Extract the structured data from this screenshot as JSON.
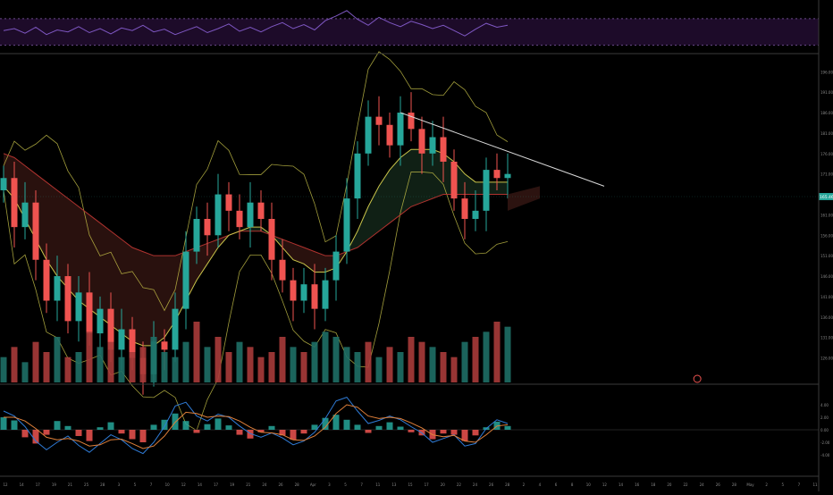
{
  "colors": {
    "background": "#000000",
    "pane_border": "#3a3a3a",
    "axis_text": "#8a8a8a",
    "candle_up": "#26a69a",
    "candle_down": "#ef5350",
    "volume_up": "#1e6f66",
    "volume_down": "#a83b3a",
    "rsi_line": "#7e57c2",
    "rsi_band": "#2a0f3a",
    "bb_band": "#c9c44a",
    "ema_short": "#c9c44a",
    "ema_long": "#b0332f",
    "cloud_bull": "#1d3a26",
    "cloud_bear": "#4a1f1a",
    "trendline": "#d8d8d8",
    "macd_line": "#2f7bd6",
    "signal_line": "#e0803a",
    "hist_up": "#26a69a",
    "hist_down": "#ef5350",
    "price_tag": "#26a69a",
    "event_marker": "#ef5350"
  },
  "icons": {
    "event_marker": "earnings-event-icon"
  },
  "chart_data": [
    {
      "type": "line",
      "name": "rsi-pane",
      "overbought": 70,
      "oversold": 30,
      "ylim": [
        20,
        90
      ],
      "x_range": [
        0,
        48
      ],
      "values": [
        52,
        55,
        48,
        57,
        46,
        53,
        50,
        58,
        49,
        55,
        47,
        56,
        52,
        60,
        50,
        54,
        46,
        52,
        58,
        49,
        55,
        62,
        51,
        57,
        50,
        58,
        64,
        55,
        61,
        53,
        67,
        74,
        82,
        69,
        60,
        72,
        64,
        58,
        66,
        61,
        55,
        60,
        52,
        44,
        54,
        63,
        57,
        60
      ]
    },
    {
      "type": "line",
      "name": "price-pane",
      "ylim": [
        120,
        200
      ],
      "x_range": [
        0,
        48
      ],
      "projection_end": 56,
      "close": [
        170,
        158,
        164,
        150,
        140,
        146,
        135,
        142,
        132,
        138,
        128,
        133,
        126,
        122,
        130,
        128,
        138,
        152,
        160,
        156,
        166,
        162,
        158,
        164,
        160,
        150,
        145,
        140,
        144,
        138,
        145,
        152,
        165,
        176,
        185,
        183,
        178,
        186,
        182,
        176,
        180,
        174,
        165,
        160,
        162,
        172,
        170,
        171
      ],
      "ema_short": [
        168,
        165,
        160,
        155,
        150,
        146,
        143,
        140,
        138,
        136,
        134,
        132,
        130,
        129,
        129,
        131,
        135,
        140,
        145,
        149,
        153,
        156,
        157,
        158,
        158,
        156,
        153,
        150,
        149,
        147,
        147,
        148,
        152,
        157,
        163,
        168,
        172,
        175,
        177,
        177,
        177,
        176,
        174,
        171,
        169,
        169,
        169,
        169
      ],
      "ema_long": [
        176,
        175,
        173,
        171,
        169,
        167,
        165,
        163,
        161,
        159,
        157,
        155,
        153,
        152,
        151,
        151,
        151,
        152,
        153,
        154,
        155,
        156,
        157,
        157,
        157,
        156,
        155,
        154,
        153,
        152,
        151,
        151,
        152,
        153,
        155,
        157,
        159,
        161,
        163,
        164,
        165,
        166,
        166,
        166,
        166,
        166,
        166,
        166
      ],
      "trendline": {
        "x": [
          37,
          56
        ],
        "y": [
          186,
          168
        ]
      },
      "event_marker_index": 66,
      "y_ticks": [
        126,
        131,
        136,
        141,
        146,
        151,
        156,
        161,
        166,
        171,
        176,
        181,
        186,
        191,
        196
      ],
      "current_price": "165.46",
      "x_tick_labels": [
        "12",
        "14",
        "17",
        "19",
        "21",
        "25",
        "28",
        "3",
        "5",
        "7",
        "10",
        "12",
        "14",
        "17",
        "19",
        "21",
        "24",
        "26",
        "28",
        "Apr",
        "3",
        "5",
        "7",
        "11",
        "13",
        "15",
        "17",
        "20",
        "22",
        "24",
        "26",
        "28",
        "2",
        "4",
        "6",
        "8",
        "10",
        "12",
        "14",
        "16",
        "18",
        "20",
        "22",
        "24",
        "26",
        "28",
        "May",
        "2",
        "5",
        "7",
        "11"
      ]
    },
    {
      "type": "bar",
      "name": "volume",
      "values": [
        5,
        7,
        4,
        8,
        6,
        9,
        5,
        6,
        10,
        7,
        8,
        5,
        6,
        7,
        9,
        6,
        5,
        8,
        12,
        7,
        9,
        6,
        8,
        7,
        5,
        6,
        9,
        7,
        6,
        8,
        10,
        9,
        7,
        6,
        8,
        5,
        7,
        6,
        9,
        8,
        7,
        6,
        5,
        8,
        9,
        10,
        12,
        11
      ],
      "directions": [
        1,
        0,
        1,
        0,
        0,
        1,
        0,
        1,
        0,
        1,
        0,
        1,
        0,
        0,
        1,
        1,
        1,
        1,
        0,
        1,
        0,
        0,
        1,
        0,
        0,
        0,
        0,
        1,
        0,
        1,
        1,
        1,
        1,
        1,
        0,
        1,
        0,
        1,
        0,
        0,
        1,
        0,
        0,
        1,
        0,
        1,
        0,
        1
      ]
    },
    {
      "type": "bar",
      "name": "macd-pane",
      "ylim": [
        -7,
        7
      ],
      "y_ticks": [
        "4.00",
        "2.00",
        "0.00",
        "-2.00",
        "-4.00"
      ],
      "histogram": [
        2.0,
        1.5,
        -1.2,
        -2.2,
        -0.8,
        1.4,
        0.6,
        -1.0,
        -1.8,
        0.4,
        1.2,
        -0.6,
        -1.5,
        -2.0,
        0.8,
        1.6,
        2.6,
        1.4,
        -0.5,
        0.9,
        1.8,
        0.7,
        -0.8,
        -1.4,
        -0.4,
        0.6,
        -0.9,
        -1.6,
        -0.6,
        0.8,
        1.9,
        2.4,
        1.6,
        0.8,
        -0.5,
        0.6,
        1.2,
        0.5,
        -0.4,
        -0.9,
        -1.5,
        -0.6,
        -0.8,
        -1.8,
        -0.9,
        0.4,
        1.3,
        0.6
      ],
      "macd": [
        3.0,
        2.2,
        0.5,
        -1.8,
        -3.2,
        -2.0,
        -1.0,
        -2.5,
        -3.6,
        -2.2,
        -0.8,
        -1.6,
        -3.0,
        -3.8,
        -2.0,
        0.5,
        3.8,
        4.4,
        2.2,
        1.4,
        2.5,
        2.0,
        0.6,
        -0.6,
        -1.2,
        -0.5,
        -1.3,
        -2.4,
        -1.8,
        -0.4,
        1.8,
        4.6,
        5.2,
        3.0,
        1.0,
        1.5,
        2.2,
        1.6,
        0.5,
        -0.5,
        -2.0,
        -1.4,
        -0.8,
        -2.6,
        -2.2,
        0.2,
        1.6,
        1.0
      ],
      "signal": [
        2.0,
        2.0,
        1.4,
        0.2,
        -1.2,
        -1.6,
        -1.4,
        -1.8,
        -2.6,
        -2.4,
        -1.6,
        -1.5,
        -2.2,
        -3.0,
        -2.6,
        -1.0,
        1.2,
        2.8,
        2.6,
        2.0,
        2.2,
        2.1,
        1.4,
        0.4,
        -0.4,
        -0.5,
        -0.8,
        -1.6,
        -1.7,
        -1.0,
        0.4,
        2.6,
        4.0,
        3.6,
        2.2,
        1.8,
        2.0,
        1.8,
        1.1,
        0.3,
        -0.8,
        -1.1,
        -0.9,
        -1.8,
        -2.0,
        -0.8,
        0.6,
        0.8
      ]
    }
  ]
}
